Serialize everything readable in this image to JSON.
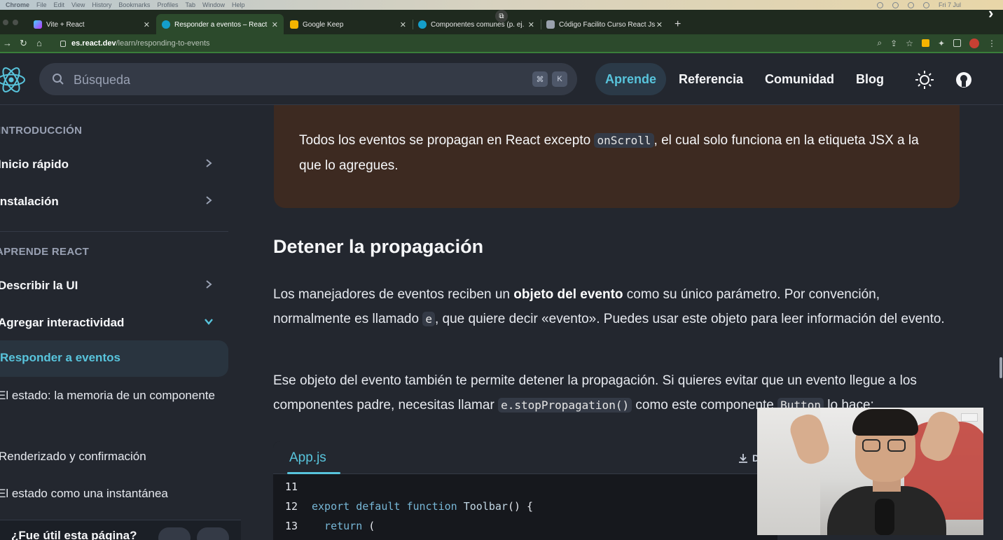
{
  "macbar": {
    "items": [
      "Chrome",
      "File",
      "Edit",
      "View",
      "History",
      "Bookmarks",
      "Profiles",
      "Tab",
      "Window",
      "Help"
    ],
    "clock": "Fri 7 Jul"
  },
  "tabs": [
    {
      "title": "Vite + React",
      "favicon_color": "#a855f7"
    },
    {
      "title": "Responder a eventos – React",
      "favicon_color": "#149eca"
    },
    {
      "title": "Google Keep",
      "favicon_color": "#f5b400"
    },
    {
      "title": "Componentes comunes (p. ej.",
      "favicon_color": "#149eca"
    },
    {
      "title": "Código Facilito Curso React Js",
      "favicon_color": "#9aa1ad"
    }
  ],
  "address": {
    "host": "es.react.dev",
    "path": "/learn/responding-to-events"
  },
  "header": {
    "search_placeholder": "Búsqueda",
    "kbd": [
      "⌘",
      "K"
    ],
    "nav": [
      "Aprende",
      "Referencia",
      "Comunidad",
      "Blog"
    ],
    "accent": "#58c4dc"
  },
  "sidebar": {
    "section_intro": "INTRODUCCIÓN",
    "quick_start": "Inicio rápido",
    "installation": "Instalación",
    "section_learn": "APRENDE REACT",
    "describe_ui": "Describir la UI",
    "add_interactivity": "Agregar interactividad",
    "active_item": "Responder a eventos",
    "sub_items": [
      "El estado: la memoria de un componente",
      "Renderizado y confirmación",
      "El estado como una instantánea"
    ],
    "feedback": "¿Fue útil esta página?"
  },
  "content": {
    "note_before": "Todos los eventos se propagan en React excepto ",
    "note_code": "onScroll",
    "note_after": ", el cual solo funciona en la etiqueta JSX a la que lo agregues.",
    "heading": "Detener la propagación",
    "p1_a": "Los manejadores de eventos reciben un ",
    "p1_bold": "objeto del evento",
    "p1_b": " como su único parámetro. Por convención, normalmente es llamado ",
    "p1_code": "e",
    "p1_c": ", que quiere decir «evento». Puedes usar este objeto para leer información del evento.",
    "p2_a": "Ese objeto del evento también te permite detener la propagación. Si quieres evitar que un evento llegue a los componentes padre, necesitas llamar ",
    "p2_code": "e.stopPropagation()",
    "p2_b": " como este componente ",
    "p2_code2": "Button",
    "p2_c": " lo hace:"
  },
  "code": {
    "filename": "App.js",
    "download_label": "D",
    "lines": [
      {
        "n": "11",
        "text": ""
      },
      {
        "n": "12",
        "kw": "export default function ",
        "fn": "Toolbar",
        "rest": "() {"
      },
      {
        "n": "13",
        "kw": "  return ",
        "fn": "",
        "rest": "("
      }
    ]
  }
}
